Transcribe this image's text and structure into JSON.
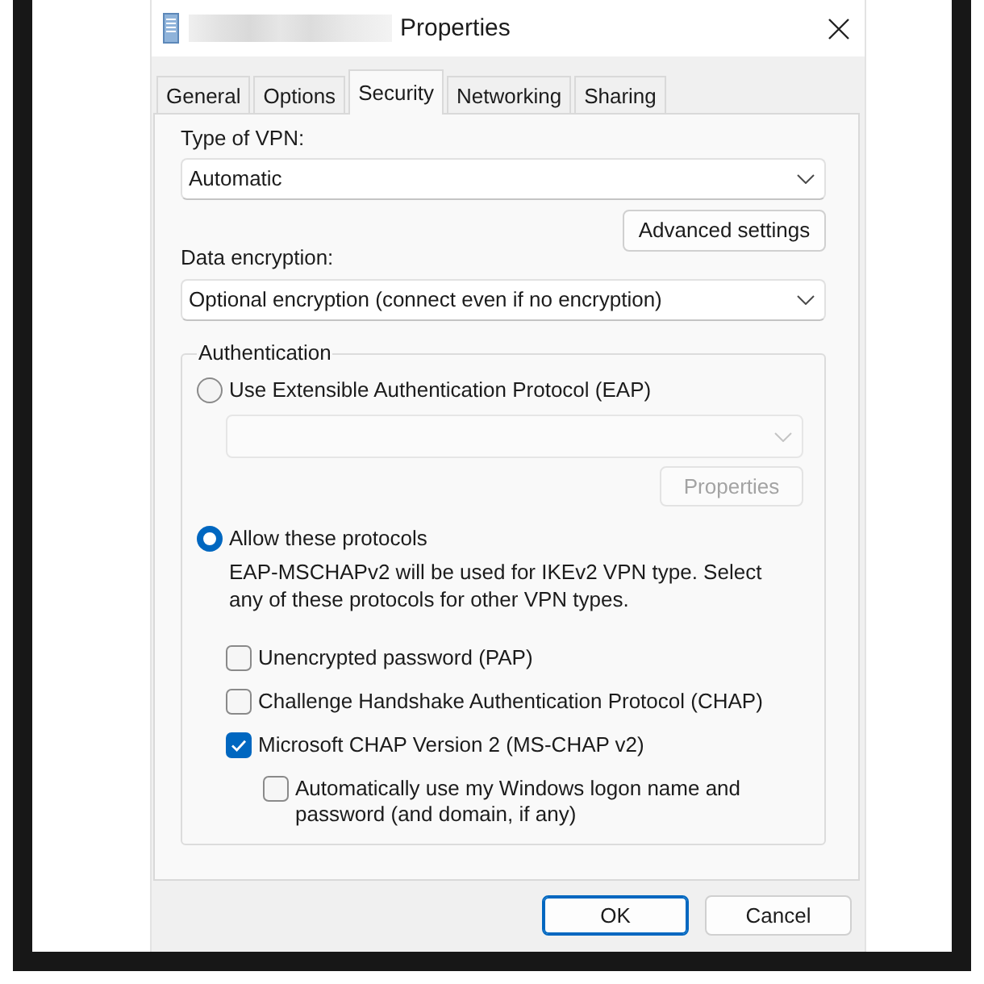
{
  "window": {
    "title": "Properties"
  },
  "tabs": [
    {
      "label": "General",
      "selected": false
    },
    {
      "label": "Options",
      "selected": false
    },
    {
      "label": "Security",
      "selected": true
    },
    {
      "label": "Networking",
      "selected": false
    },
    {
      "label": "Sharing",
      "selected": false
    }
  ],
  "vpn_type": {
    "label": "Type of VPN:",
    "value": "Automatic"
  },
  "advanced_settings": {
    "label": "Advanced settings"
  },
  "data_encryption": {
    "label": "Data encryption:",
    "value": "Optional encryption (connect even if no encryption)"
  },
  "authentication": {
    "title": "Authentication",
    "options": [
      {
        "kind": "eap",
        "label": "Use Extensible Authentication Protocol (EAP)",
        "selected": false,
        "method_dropdown": {
          "disabled": true
        },
        "properties_button": {
          "label": "Properties",
          "disabled": true
        }
      },
      {
        "kind": "protocols",
        "label": "Allow these protocols",
        "selected": true,
        "description": "EAP-MSCHAPv2 will be used for IKEv2 VPN type. Select any of these protocols for other VPN types.",
        "protocols": [
          {
            "label": "Unencrypted password (PAP)",
            "checked": false
          },
          {
            "label": "Challenge Handshake Authentication Protocol (CHAP)",
            "checked": false
          },
          {
            "label": "Microsoft CHAP Version 2 (MS-CHAP v2)",
            "checked": true,
            "children": [
              {
                "label": "Automatically use my Windows logon name and password (and domain, if any)",
                "checked": false
              }
            ]
          }
        ]
      }
    ]
  },
  "buttons": [
    {
      "label": "OK",
      "default": true
    },
    {
      "label": "Cancel",
      "default": false
    }
  ]
}
